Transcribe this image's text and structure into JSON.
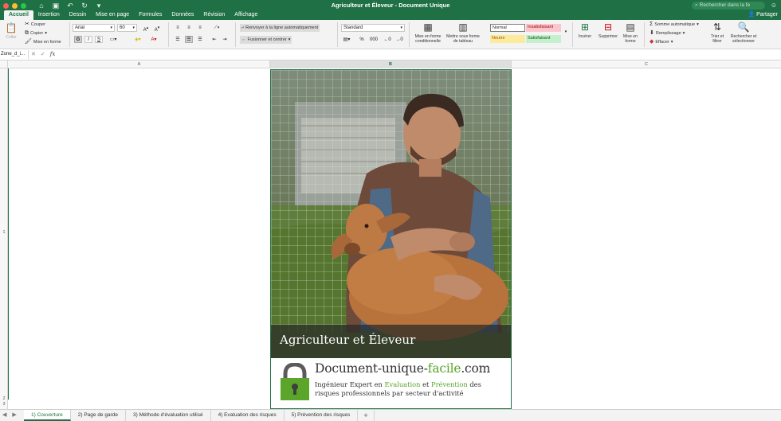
{
  "window": {
    "title": "Agriculteur et Éleveur - Document Unique",
    "search_placeholder": "Rechercher dans la fe",
    "share_label": "Partager"
  },
  "quick_access": [
    "home-icon",
    "save-icon",
    "undo-icon",
    "redo-icon",
    "customize-icon"
  ],
  "menu_tabs": [
    "Accueil",
    "Insertion",
    "Dessin",
    "Mise en page",
    "Formules",
    "Données",
    "Révision",
    "Affichage"
  ],
  "ribbon": {
    "paste": "Coller",
    "cut": "Couper",
    "copy": "Copier",
    "format_painter": "Mise en forme",
    "font_name": "Arial",
    "font_size": "60",
    "bold": "G",
    "italic": "I",
    "underline": "S",
    "wrap_text": "Renvoyer à la ligne automatiquement",
    "merge_center": "Fusionner et centrer",
    "number_format": "Standard",
    "percent": "%",
    "thousands": "000",
    "conditional_format": "Mise en forme conditionnelle",
    "format_as_table": "Mettre sous forme de tableau",
    "styles": {
      "normal": "Normal",
      "bad": "Insatisfaisant",
      "neutral": "Neutre",
      "good": "Satisfaisant"
    },
    "insert": "Insérer",
    "delete": "Supprimer",
    "format": "Mise en forme",
    "autosum": "Somme automatique",
    "fill": "Remplissage",
    "clear": "Effacer",
    "sort_filter": "Trier et filtrer",
    "find_select": "Rechercher et sélectionner"
  },
  "formula_bar": {
    "name_box": "Zone_d_i...",
    "fx": "fx",
    "value": ""
  },
  "columns": [
    "A",
    "B",
    "C"
  ],
  "rows": [
    "1",
    "2",
    "3"
  ],
  "cover": {
    "caption": "Agriculteur et Éleveur",
    "brand_main": "Document-unique-",
    "brand_accent": "facile",
    "brand_tail": ".com",
    "tag_1": "Ingénieur Expert en ",
    "tag_eval": "Evaluation",
    "tag_2": " et ",
    "tag_prev": "Prévention",
    "tag_3": " des risques professionnels par secteur d'activité"
  },
  "sheet_tabs": [
    "1) Couverture",
    "2) Page de garde",
    "3) Méthode d'évaluation utilisé",
    "4) Evaluation des risques",
    "5) Prévention des risques"
  ],
  "add_sheet": "+",
  "colors": {
    "accent": "#1f7145",
    "brand_green": "#5aa52a"
  }
}
